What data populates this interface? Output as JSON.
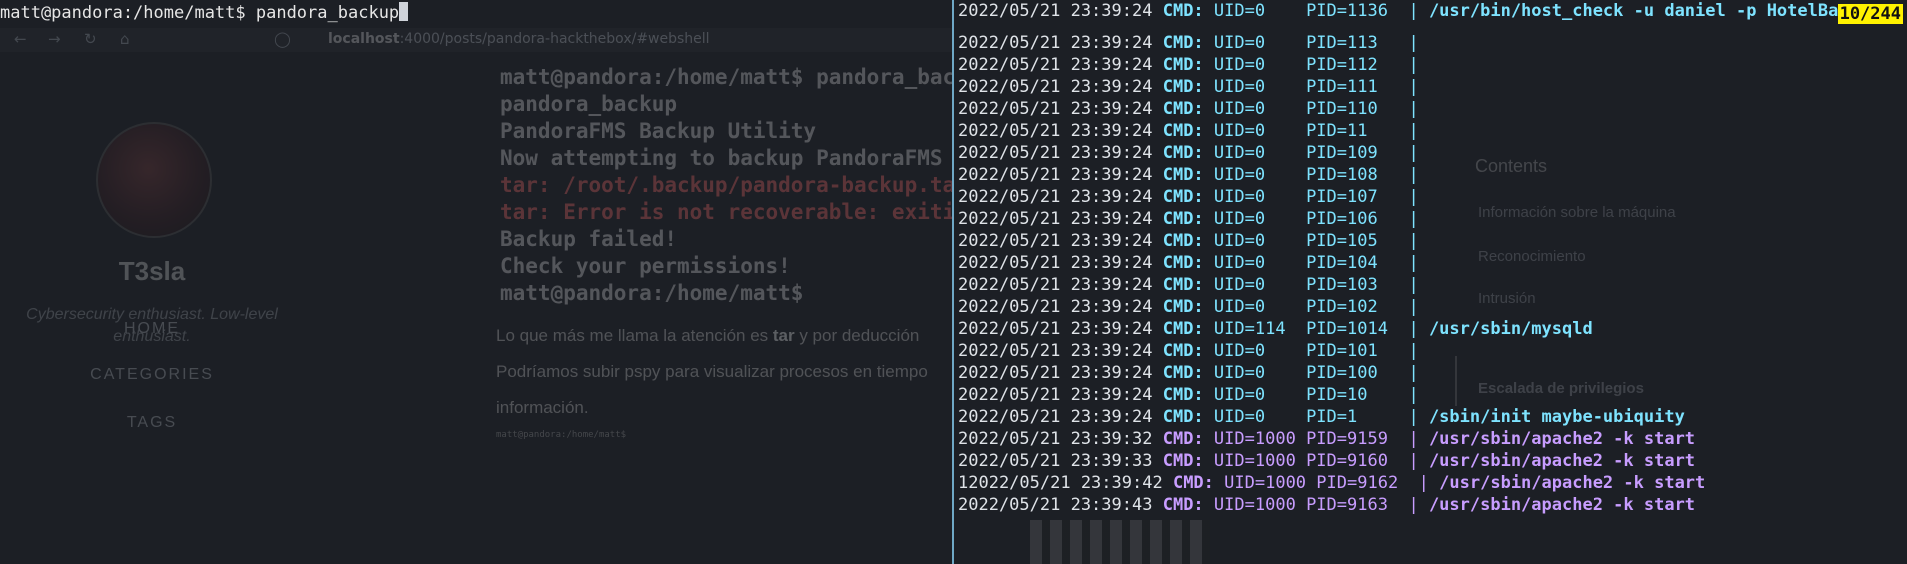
{
  "left_terminal": {
    "prompt": "matt@pandora:/home/matt$ pandora_backup"
  },
  "browser": {
    "url_host": "localhost",
    "url_path": ":4000/posts/pandora-hackthebox/#webshell",
    "zoom": "120%"
  },
  "profile": {
    "name": "T3sla",
    "tagline": "Cybersecurity enthusiast. Low-level enthusiast.",
    "nav": [
      "HOME",
      "CATEGORIES",
      "TAGS"
    ]
  },
  "post": {
    "code_lines": [
      "matt@pandora:/home/matt$ pandora_backup",
      "pandora_backup",
      "PandoraFMS Backup Utility",
      "Now attempting to backup PandoraFMS c",
      "tar: /root/.backup/pandora-backup.tar",
      "tar: Error is not recoverable: exitin",
      "Backup failed!",
      "Check your permissions!",
      "matt@pandora:/home/matt$"
    ],
    "paragraph_1a": "Lo que más me llama la atención es ",
    "paragraph_1b": "tar",
    "paragraph_1c": " y por deducción",
    "paragraph_2": "Podríamos subir pspy para visualizar procesos en tiempo",
    "paragraph_3": "información.",
    "small_prompt": "matt@pandora:/home/matt$"
  },
  "toc": {
    "title": "Contents",
    "items": [
      "Información sobre la máquina",
      "Reconocimiento",
      "Intrusión",
      "Escalada de privilegios"
    ]
  },
  "pspy": {
    "scroll_position": "10/244",
    "lines": [
      {
        "ts": "2022/05/21 23:39:24",
        "tag": "CMD:",
        "uid": "UID=0   ",
        "pid": "PID=1136 ",
        "cmd": "/usr/bin/host_check -u daniel -p HotelBa",
        "kind": "root"
      },
      {
        "gap": true
      },
      {
        "ts": "2022/05/21 23:39:24",
        "tag": "CMD:",
        "uid": "UID=0   ",
        "pid": "PID=113  ",
        "cmd": "",
        "kind": "root"
      },
      {
        "ts": "2022/05/21 23:39:24",
        "tag": "CMD:",
        "uid": "UID=0   ",
        "pid": "PID=112  ",
        "cmd": "",
        "kind": "root"
      },
      {
        "ts": "2022/05/21 23:39:24",
        "tag": "CMD:",
        "uid": "UID=0   ",
        "pid": "PID=111  ",
        "cmd": "",
        "kind": "root"
      },
      {
        "ts": "2022/05/21 23:39:24",
        "tag": "CMD:",
        "uid": "UID=0   ",
        "pid": "PID=110  ",
        "cmd": "",
        "kind": "root"
      },
      {
        "ts": "2022/05/21 23:39:24",
        "tag": "CMD:",
        "uid": "UID=0   ",
        "pid": "PID=11   ",
        "cmd": "",
        "kind": "root"
      },
      {
        "ts": "2022/05/21 23:39:24",
        "tag": "CMD:",
        "uid": "UID=0   ",
        "pid": "PID=109  ",
        "cmd": "",
        "kind": "root"
      },
      {
        "ts": "2022/05/21 23:39:24",
        "tag": "CMD:",
        "uid": "UID=0   ",
        "pid": "PID=108  ",
        "cmd": "",
        "kind": "root"
      },
      {
        "ts": "2022/05/21 23:39:24",
        "tag": "CMD:",
        "uid": "UID=0   ",
        "pid": "PID=107  ",
        "cmd": "",
        "kind": "root"
      },
      {
        "ts": "2022/05/21 23:39:24",
        "tag": "CMD:",
        "uid": "UID=0   ",
        "pid": "PID=106  ",
        "cmd": "",
        "kind": "root"
      },
      {
        "ts": "2022/05/21 23:39:24",
        "tag": "CMD:",
        "uid": "UID=0   ",
        "pid": "PID=105  ",
        "cmd": "",
        "kind": "root"
      },
      {
        "ts": "2022/05/21 23:39:24",
        "tag": "CMD:",
        "uid": "UID=0   ",
        "pid": "PID=104  ",
        "cmd": "",
        "kind": "root"
      },
      {
        "ts": "2022/05/21 23:39:24",
        "tag": "CMD:",
        "uid": "UID=0   ",
        "pid": "PID=103  ",
        "cmd": "",
        "kind": "root"
      },
      {
        "ts": "2022/05/21 23:39:24",
        "tag": "CMD:",
        "uid": "UID=0   ",
        "pid": "PID=102  ",
        "cmd": "",
        "kind": "root"
      },
      {
        "ts": "2022/05/21 23:39:24",
        "tag": "CMD:",
        "uid": "UID=114 ",
        "pid": "PID=1014 ",
        "cmd": "/usr/sbin/mysqld",
        "kind": "root"
      },
      {
        "ts": "2022/05/21 23:39:24",
        "tag": "CMD:",
        "uid": "UID=0   ",
        "pid": "PID=101  ",
        "cmd": "",
        "kind": "root"
      },
      {
        "ts": "2022/05/21 23:39:24",
        "tag": "CMD:",
        "uid": "UID=0   ",
        "pid": "PID=100  ",
        "cmd": "",
        "kind": "root"
      },
      {
        "ts": "2022/05/21 23:39:24",
        "tag": "CMD:",
        "uid": "UID=0   ",
        "pid": "PID=10   ",
        "cmd": "",
        "kind": "root"
      },
      {
        "ts": "2022/05/21 23:39:24",
        "tag": "CMD:",
        "uid": "UID=0   ",
        "pid": "PID=1    ",
        "cmd": "/sbin/init maybe-ubiquity",
        "kind": "root"
      },
      {
        "ts": "2022/05/21 23:39:32",
        "tag": "CMD:",
        "uid": "UID=1000",
        "pid": "PID=9159 ",
        "cmd": "/usr/sbin/apache2 -k start",
        "kind": "user"
      },
      {
        "ts": "2022/05/21 23:39:33",
        "tag": "CMD:",
        "uid": "UID=1000",
        "pid": "PID=9160 ",
        "cmd": "/usr/sbin/apache2 -k start",
        "kind": "user"
      },
      {
        "ts": "12022/05/21 23:39:42",
        "tag": "CMD:",
        "uid": "UID=1000",
        "pid": "PID=9162 ",
        "cmd": "/usr/sbin/apache2 -k start",
        "kind": "user"
      },
      {
        "ts": "2022/05/21 23:39:43",
        "tag": "CMD:",
        "uid": "UID=1000",
        "pid": "PID=9163 ",
        "cmd": "/usr/sbin/apache2 -k start",
        "kind": "user"
      }
    ]
  }
}
